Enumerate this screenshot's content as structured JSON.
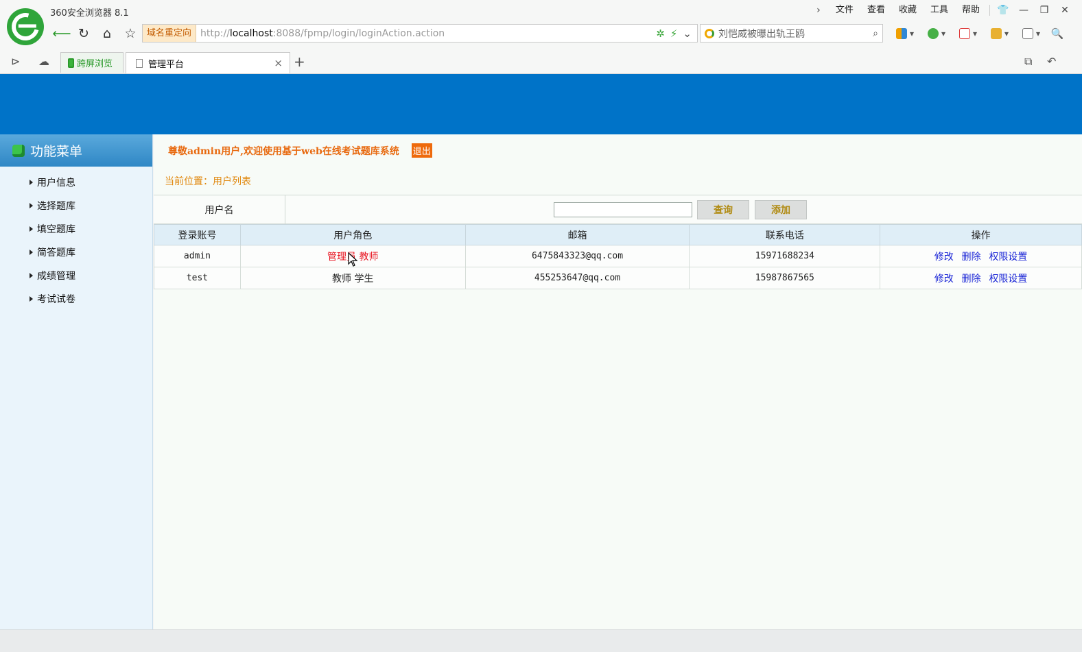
{
  "browser": {
    "title": "360安全浏览器 8.1",
    "menu": [
      "文件",
      "查看",
      "收藏",
      "工具",
      "帮助"
    ],
    "redirect_label": "域名重定向",
    "url_prefix": "http://",
    "url_host": "localhost",
    "url_rest": ":8088/fpmp/login/loginAction.action",
    "search_text": "刘恺威被曝出轨王鸥",
    "tabs": [
      {
        "label": "跨屏浏览"
      },
      {
        "label": "管理平台"
      }
    ]
  },
  "sidebar": {
    "title": "功能菜单",
    "items": [
      {
        "label": "用户信息"
      },
      {
        "label": "选择题库"
      },
      {
        "label": "填空题库"
      },
      {
        "label": "简答题库"
      },
      {
        "label": "成绩管理"
      },
      {
        "label": "考试试卷"
      }
    ]
  },
  "main": {
    "welcome": "尊敬admin用户,欢迎使用基于web在线考试题库系统",
    "logout_label": "退出",
    "breadcrumb": "当前位置：用户列表",
    "query": {
      "label": "用户名",
      "value": "",
      "search_label": "查询",
      "add_label": "添加"
    },
    "table": {
      "headers": [
        "登录账号",
        "用户角色",
        "邮箱",
        "联系电话",
        "操作"
      ],
      "rows": [
        {
          "account": "admin",
          "role": "管理员 教师",
          "email": "6475843323@qq.com",
          "phone": "15971688234"
        },
        {
          "account": "test",
          "role": "教师 学生",
          "email": "455253647@qq.com",
          "phone": "15987867565"
        }
      ],
      "ops": {
        "edit": "修改",
        "delete": "删除",
        "perm": "权限设置"
      }
    }
  },
  "colors": {
    "banner": "#0073c8",
    "welcome_text": "#e86a10",
    "link": "#1a25d6",
    "role_highlight": "#e8121e"
  }
}
